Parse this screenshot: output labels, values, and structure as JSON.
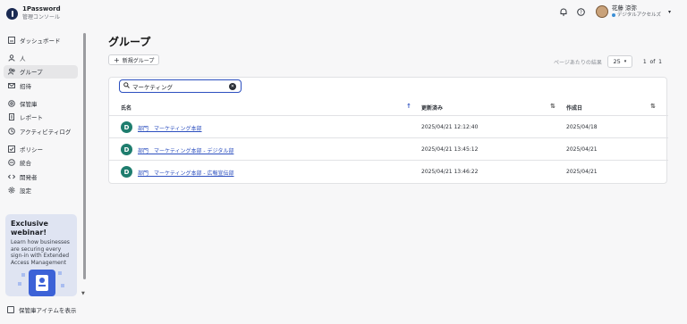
{
  "brand": {
    "name": "1Password",
    "subtitle": "管理コンソール"
  },
  "sidebar": {
    "items": [
      {
        "label": "ダッシュボード",
        "icon": "dashboard-icon"
      },
      {
        "label": "人",
        "icon": "person-icon"
      },
      {
        "label": "グループ",
        "icon": "group-icon",
        "active": true
      },
      {
        "label": "招待",
        "icon": "invite-icon"
      },
      {
        "label": "保管庫",
        "icon": "vault-icon"
      },
      {
        "label": "レポート",
        "icon": "report-icon"
      },
      {
        "label": "アクティビティログ",
        "icon": "activity-log-icon"
      },
      {
        "label": "ポリシー",
        "icon": "policy-icon"
      },
      {
        "label": "統合",
        "icon": "integration-icon"
      },
      {
        "label": "開発者",
        "icon": "developer-icon"
      },
      {
        "label": "設定",
        "icon": "settings-icon"
      }
    ],
    "promo": {
      "title": "Exclusive webinar!",
      "body": "Learn how businesses are securing every sign-in with Extended Access Management"
    },
    "footer_label": "保管庫アイテムを表示"
  },
  "topbar": {
    "user_name": "花藤 涼弥",
    "user_role": "デジタルアクセルズ"
  },
  "main": {
    "title": "グループ",
    "new_group_label": "新規グループ",
    "per_page_label": "ページあたりの結果",
    "per_page_value": "25",
    "page_current": "1",
    "page_of": "of",
    "page_total": "1",
    "search_value": "マーケティング",
    "columns": {
      "name": "氏名",
      "updated": "更新済み",
      "created": "作成日"
    },
    "rows": [
      {
        "initial": "D",
        "name": "部門　マーケティング本部",
        "updated": "2025/04/21 12:12:40",
        "created": "2025/04/18"
      },
      {
        "initial": "D",
        "name": "部門　マーケティング本部 - デジタル部",
        "updated": "2025/04/21 13:45:12",
        "created": "2025/04/21"
      },
      {
        "initial": "D",
        "name": "部門　マーケティング本部 - 広報宣伝部",
        "updated": "2025/04/21 13:46:22",
        "created": "2025/04/21"
      }
    ]
  },
  "colors": {
    "accent": "#2c4fbf",
    "badge": "#1e7d6e",
    "promo_bg": "#dfe4f2"
  }
}
